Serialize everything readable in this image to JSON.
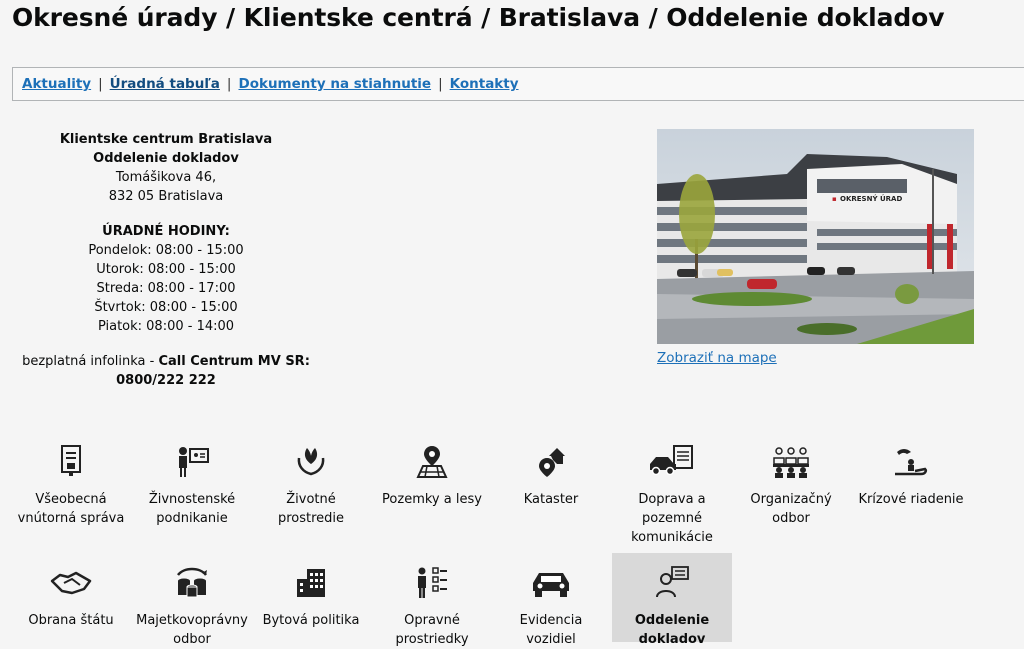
{
  "page": {
    "title": "Okresné úrady / Klientske centrá / Bratislava / Oddelenie dokladov"
  },
  "tabs": [
    {
      "label": "Aktuality",
      "active": false
    },
    {
      "label": "Úradná tabuľa",
      "active": true
    },
    {
      "label": "Dokumenty na stiahnutie",
      "active": false
    },
    {
      "label": "Kontakty",
      "active": false
    }
  ],
  "office": {
    "name": "Klientske centrum Bratislava",
    "department": "Oddelenie dokladov",
    "street": "Tomášikova 46,",
    "city": "832 05 Bratislava",
    "hours_title": "ÚRADNÉ HODINY:",
    "hours": [
      "Pondelok: 08:00 - 15:00",
      "Utorok: 08:00 - 15:00",
      "Streda: 08:00 - 17:00",
      "Štvrtok: 08:00 - 15:00",
      "Piatok: 08:00 - 14:00"
    ],
    "infoline_prefix": "bezplatná infolinka - ",
    "infoline_name": "Call Centrum MV SR:",
    "infoline_number": "0800/222 222"
  },
  "photo": {
    "sign_text": "OKRESNÝ ÚRAD"
  },
  "map_link": "Zobraziť na mape",
  "tiles": [
    {
      "label": "Všeobecná vnútorná správa",
      "icon": "document-stamp-icon"
    },
    {
      "label": "Živnostenské podnikanie",
      "icon": "trade-license-icon"
    },
    {
      "label": "Životné prostredie",
      "icon": "leaf-hands-icon"
    },
    {
      "label": "Pozemky a lesy",
      "icon": "land-pin-icon"
    },
    {
      "label": "Kataster",
      "icon": "house-pin-icon"
    },
    {
      "label": "Doprava a pozemné komunikácie",
      "icon": "car-document-icon"
    },
    {
      "label": "Organizačný odbor",
      "icon": "group-icon"
    },
    {
      "label": "Krízové riadenie",
      "icon": "hands-person-icon"
    },
    {
      "label": "Obrana štátu",
      "icon": "handshake-icon"
    },
    {
      "label": "Majetkovoprávny odbor",
      "icon": "coins-icon"
    },
    {
      "label": "Bytová politika",
      "icon": "building-icon"
    },
    {
      "label": "Opravné prostriedky",
      "icon": "person-checklist-icon"
    },
    {
      "label": "Evidencia vozidiel",
      "icon": "car-icon"
    },
    {
      "label": "Oddelenie dokladov",
      "icon": "person-id-icon",
      "active": true
    }
  ]
}
